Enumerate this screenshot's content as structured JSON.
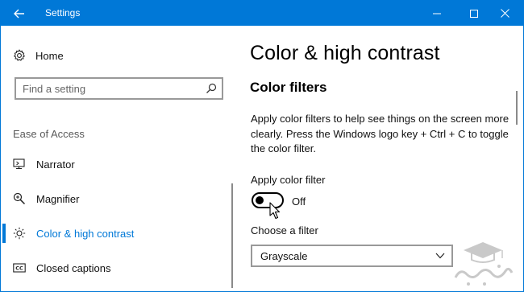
{
  "titlebar": {
    "title": "Settings",
    "bg_color": "#0078d7",
    "back_icon": "back-arrow-icon",
    "minimize_icon": "minimize-icon",
    "maximize_icon": "maximize-icon",
    "close_icon": "close-icon"
  },
  "sidebar": {
    "home": {
      "label": "Home",
      "icon": "gear-icon"
    },
    "search": {
      "placeholder": "Find a setting",
      "icon": "search-icon"
    },
    "section_label": "Ease of Access",
    "items": [
      {
        "label": "Narrator",
        "icon": "narrator-icon",
        "active": false
      },
      {
        "label": "Magnifier",
        "icon": "magnifier-icon",
        "active": false
      },
      {
        "label": "Color & high contrast",
        "icon": "sun-icon",
        "active": true
      },
      {
        "label": "Closed captions",
        "icon": "closed-captions-icon",
        "active": false
      }
    ],
    "accent_color": "#0078d7"
  },
  "main": {
    "page_title": "Color & high contrast",
    "section_title": "Color filters",
    "description": "Apply color filters to help see things on the screen more clearly. Press the Windows logo key + Ctrl + C to toggle the color filter.",
    "toggle": {
      "label": "Apply color filter",
      "state_text": "Off",
      "on": false
    },
    "filter": {
      "label": "Choose a filter",
      "value": "Grayscale",
      "icon": "chevron-down-icon"
    }
  }
}
